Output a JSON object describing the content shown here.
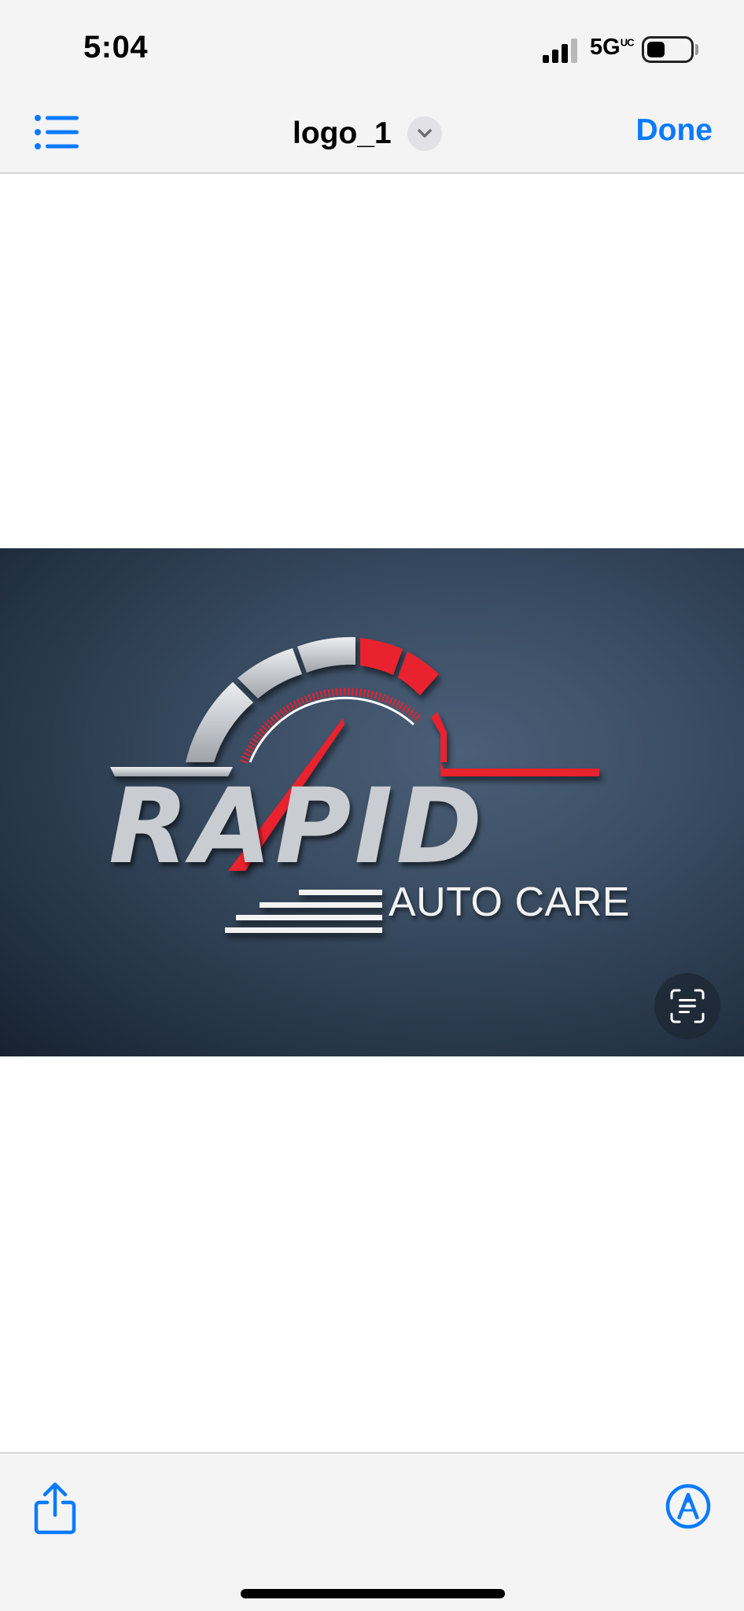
{
  "status_bar": {
    "time": "5:04",
    "network": "5G",
    "network_superscript": "UC",
    "signal_icon": "cellular-signal-icon",
    "battery_icon": "battery-icon"
  },
  "nav": {
    "list_icon": "list-icon",
    "title": "logo_1",
    "title_menu_icon": "chevron-down-icon",
    "done_label": "Done",
    "accent": "#0a7aff"
  },
  "document": {
    "image": {
      "brand_name": "RAPID",
      "tagline": "AUTO CARE",
      "accent_red": "#e8202e",
      "background": "#3a4d63"
    },
    "live_text_icon": "live-text-icon"
  },
  "toolbar": {
    "share_icon": "share-icon",
    "markup_icon": "markup-pen-icon"
  }
}
